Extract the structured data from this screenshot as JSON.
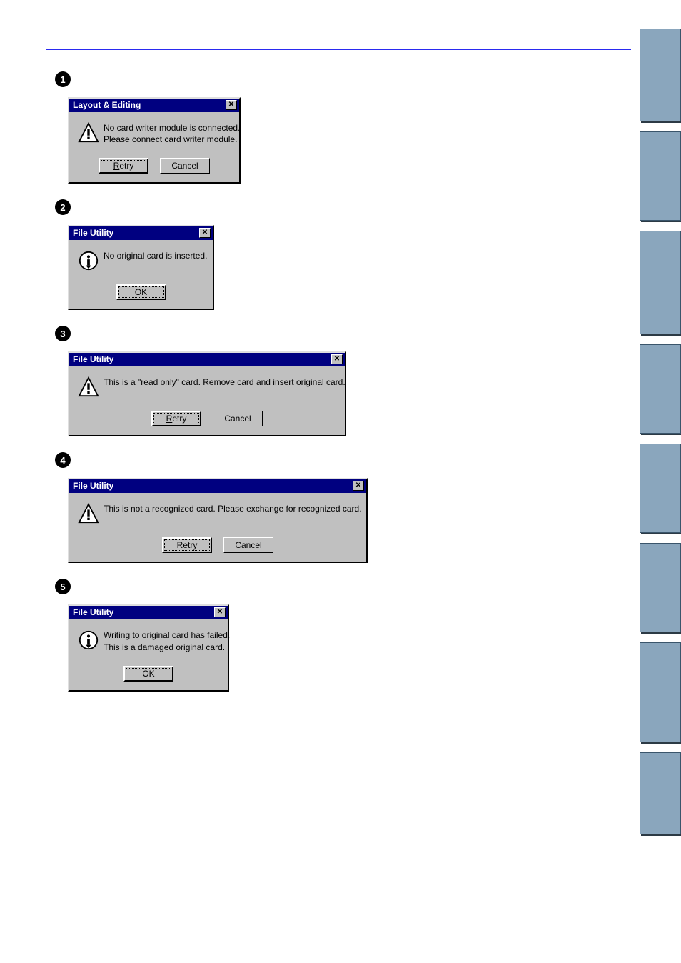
{
  "dialogs": [
    {
      "numeral": "1",
      "title": "Layout & Editing",
      "icon": "warning",
      "lines": [
        "No card writer module is connected.",
        "Please connect card writer module."
      ],
      "buttons": [
        {
          "label": "Retry",
          "underline_first": true,
          "default": true
        },
        {
          "label": "Cancel",
          "underline_first": false,
          "default": false
        }
      ],
      "size": "sm"
    },
    {
      "numeral": "2",
      "title": "File Utility",
      "icon": "info",
      "lines": [
        "No original card is inserted."
      ],
      "buttons": [
        {
          "label": "OK",
          "underline_first": false,
          "default": true
        }
      ],
      "size": "md"
    },
    {
      "numeral": "3",
      "title": "File Utility",
      "icon": "warning",
      "lines": [
        "This is a \"read only\" card. Remove card and insert original card."
      ],
      "buttons": [
        {
          "label": "Retry",
          "underline_first": true,
          "default": true
        },
        {
          "label": "Cancel",
          "underline_first": false,
          "default": false
        }
      ],
      "size": "lg1"
    },
    {
      "numeral": "4",
      "title": "File Utility",
      "icon": "warning",
      "lines": [
        "This is not a recognized card. Please exchange for recognized card."
      ],
      "buttons": [
        {
          "label": "Retry",
          "underline_first": true,
          "default": true
        },
        {
          "label": "Cancel",
          "underline_first": false,
          "default": false
        }
      ],
      "size": "lg2"
    },
    {
      "numeral": "5",
      "title": "File Utility",
      "icon": "info",
      "lines": [
        "Writing to original card has failed.",
        "This is a damaged original card."
      ],
      "buttons": [
        {
          "label": "OK",
          "underline_first": false,
          "default": true
        }
      ],
      "size": "xs"
    }
  ],
  "side_tab_heights": [
    130,
    125,
    145,
    125,
    125,
    125,
    140,
    115
  ]
}
